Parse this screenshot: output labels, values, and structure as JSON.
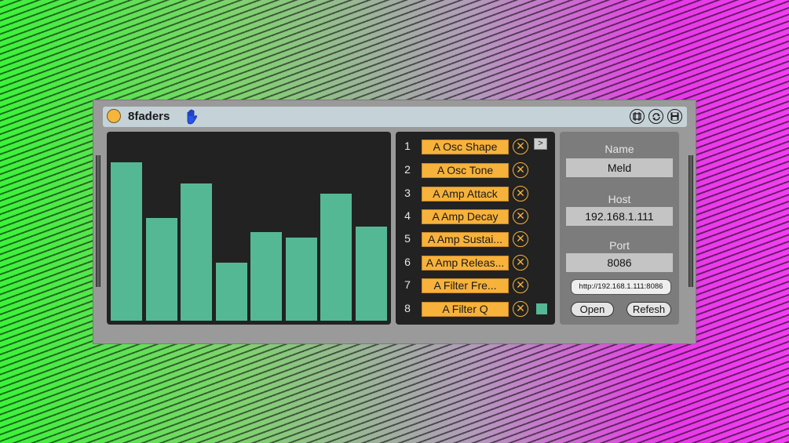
{
  "device": {
    "title": "8faders",
    "icons": [
      "power-icon",
      "hand-icon",
      "routing-icon",
      "refresh-icon",
      "save-icon"
    ]
  },
  "faders": {
    "levels": [
      0.855,
      0.555,
      0.74,
      0.315,
      0.48,
      0.45,
      0.685,
      0.51
    ],
    "color": "#55b895"
  },
  "params": [
    {
      "num": "1",
      "label": "A Osc Shape"
    },
    {
      "num": "2",
      "label": "A Osc Tone"
    },
    {
      "num": "3",
      "label": "A Amp Attack"
    },
    {
      "num": "4",
      "label": "A Amp Decay"
    },
    {
      "num": "5",
      "label": "A Amp Sustai..."
    },
    {
      "num": "6",
      "label": "A Amp Releas..."
    },
    {
      "num": "7",
      "label": "A Filter Fre..."
    },
    {
      "num": "8",
      "label": "A Filter Q"
    }
  ],
  "param_controls": {
    "remove_symbol": "✕",
    "arrow_label": ">"
  },
  "settings": {
    "name_label": "Name",
    "name_value": "Meld",
    "host_label": "Host",
    "host_value": "192.168.1.111",
    "port_label": "Port",
    "port_value": "8086",
    "url": "http://192.168.1.111:8086",
    "open_label": "Open",
    "refresh_label": "Refesh"
  },
  "colors": {
    "accent": "#f7b23b",
    "fader": "#55b895",
    "panel": "#222222",
    "titlebar": "#c5d2d8"
  }
}
